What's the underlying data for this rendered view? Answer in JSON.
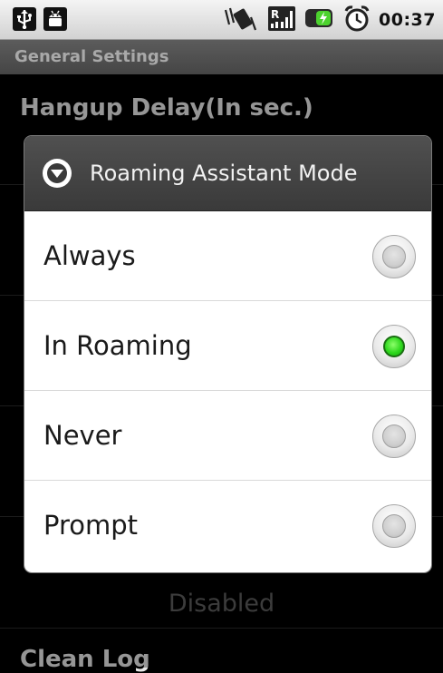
{
  "status_bar": {
    "time": "00:37",
    "left_icons": [
      "usb-icon",
      "android-debug-icon"
    ],
    "right_icons": [
      "vibrate-icon",
      "signal-roaming-icon",
      "battery-charging-icon",
      "alarm-clock-icon"
    ]
  },
  "title_bar": {
    "title": "General Settings"
  },
  "background_list": {
    "first_pref_title": "Hangup Delay(In sec.)",
    "summary_disabled": "Disabled",
    "last_pref_title": "Clean Log"
  },
  "dialog": {
    "title": "Roaming Assistant Mode",
    "header_icon": "dropdown-circle-icon",
    "options": [
      {
        "label": "Always",
        "checked": false
      },
      {
        "label": "In Roaming",
        "checked": true
      },
      {
        "label": "Never",
        "checked": false
      },
      {
        "label": "Prompt",
        "checked": false
      }
    ]
  },
  "colors": {
    "radio_selected": "#2fd81e",
    "dialog_header": "#454545",
    "title_bar_text": "#a9a9a9"
  }
}
